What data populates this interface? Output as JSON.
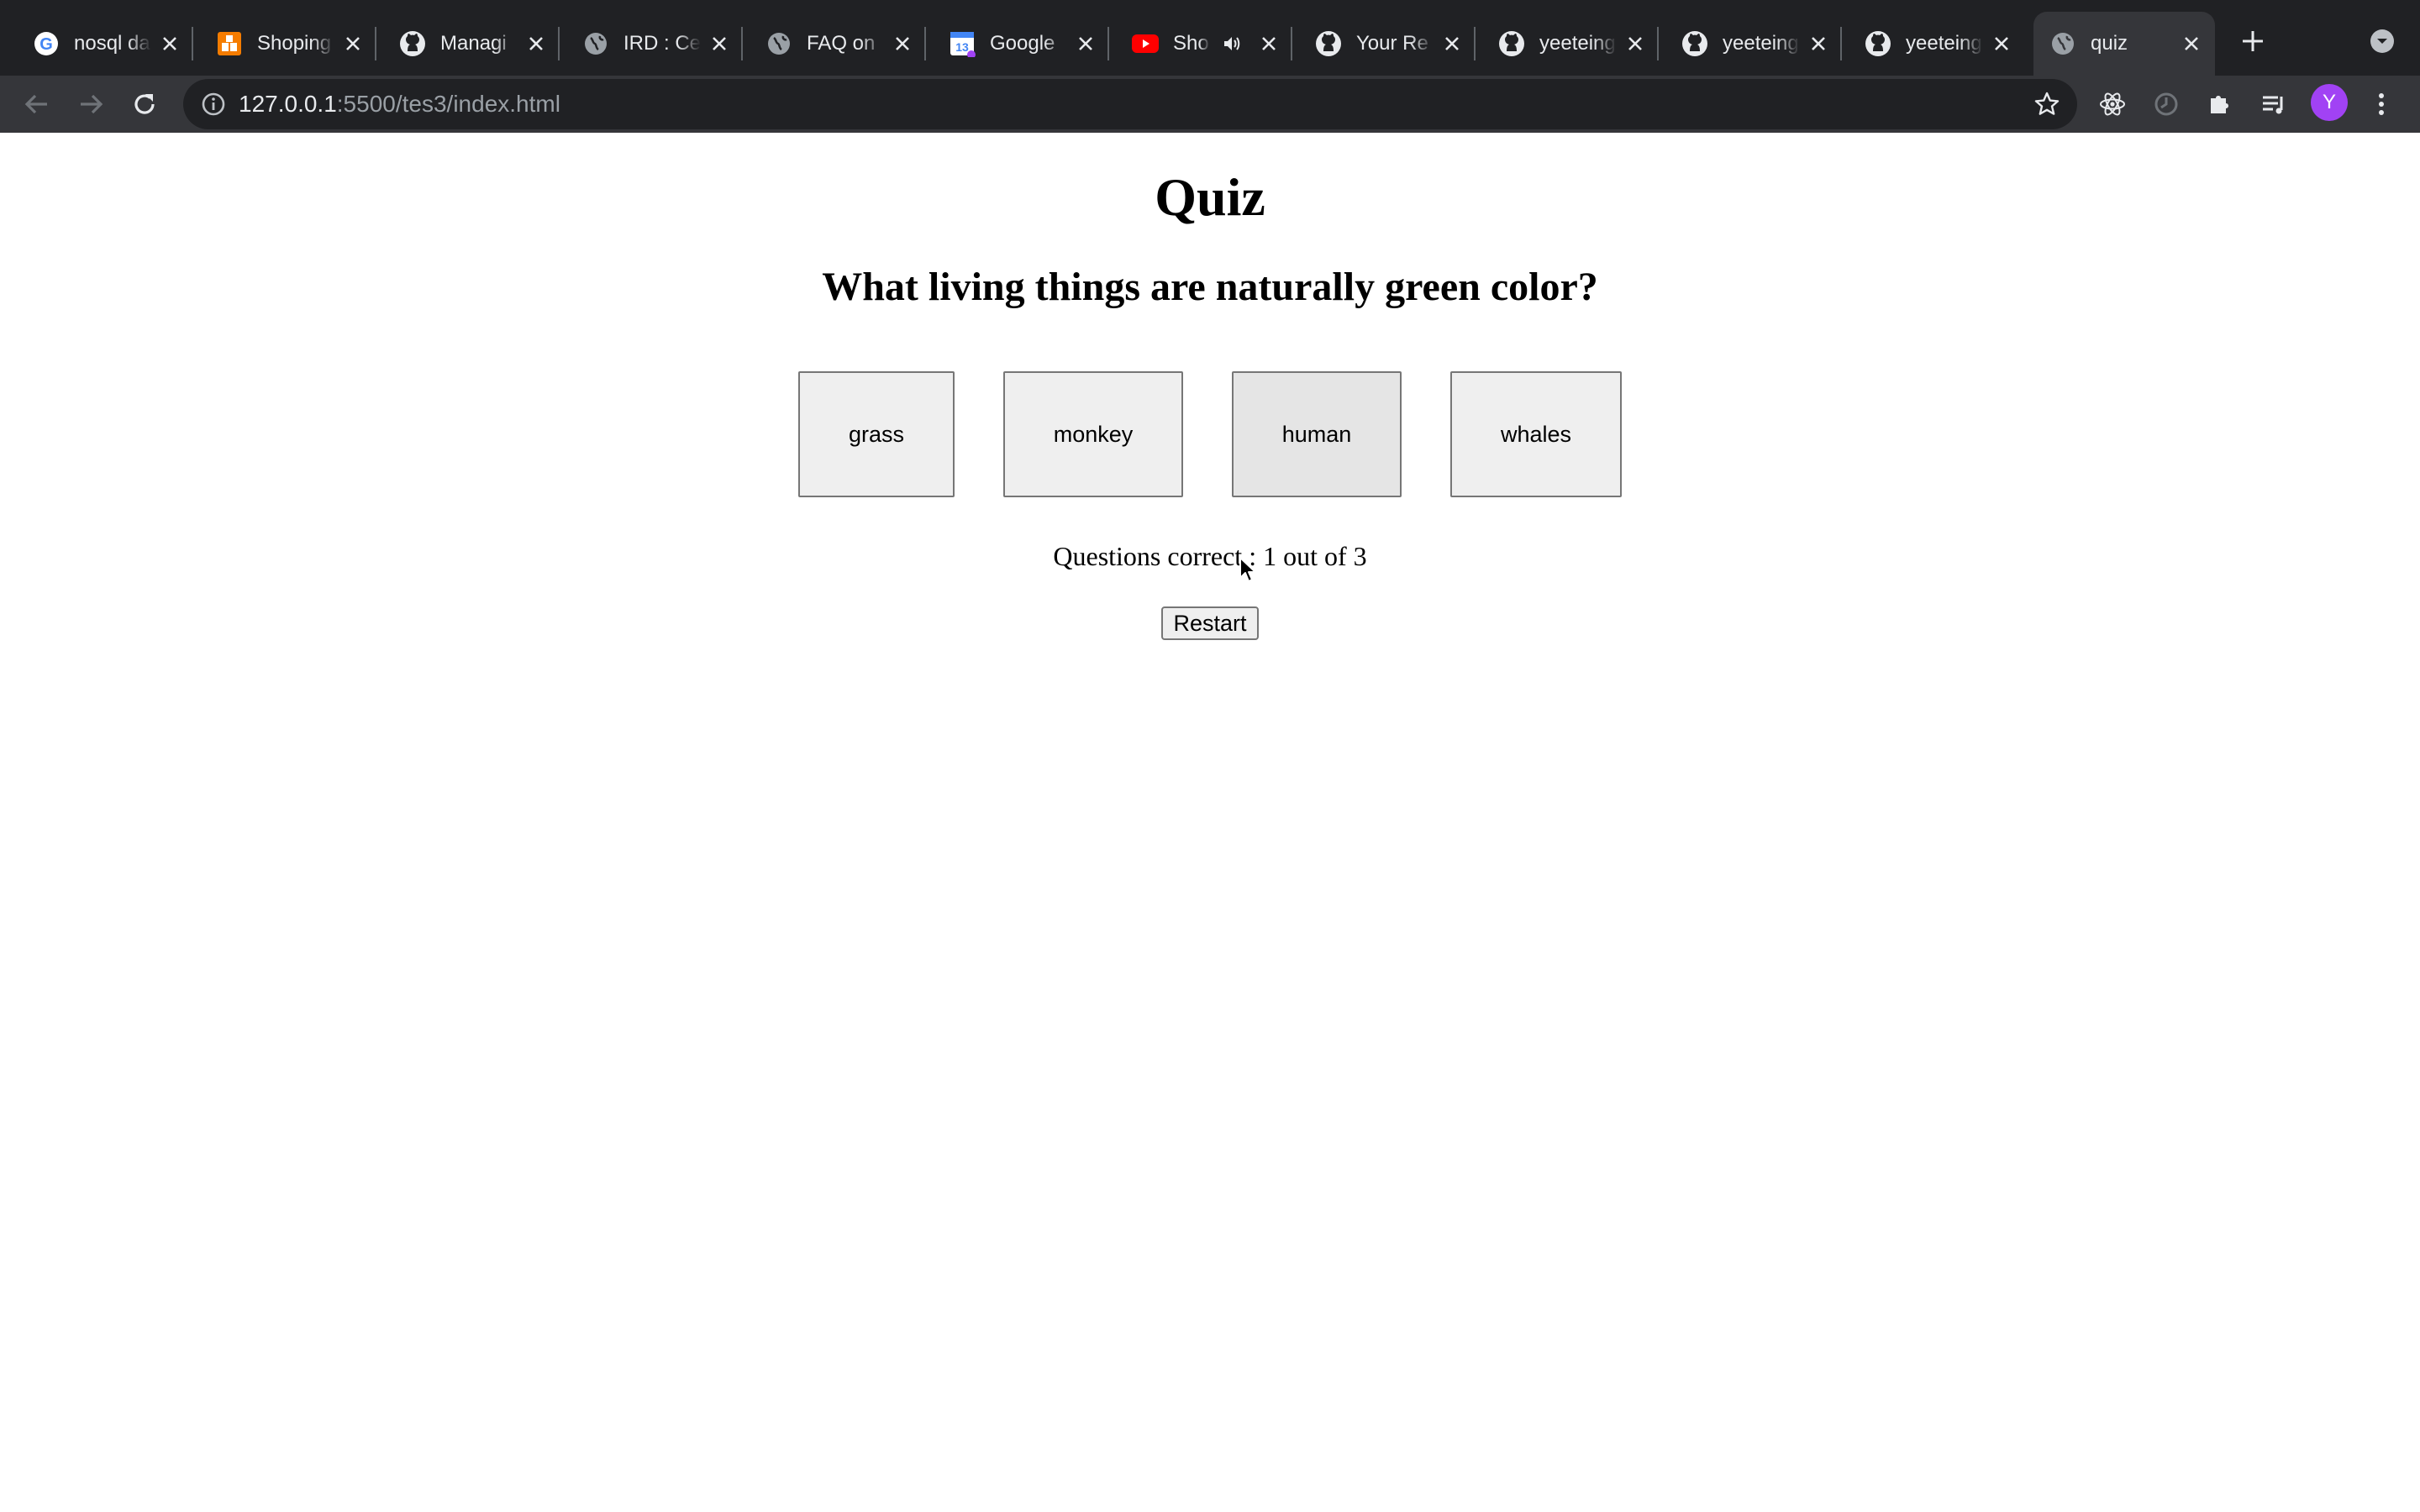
{
  "browser": {
    "tabs": [
      {
        "title": "nosql da",
        "icon": "google-icon"
      },
      {
        "title": "Shoping",
        "icon": "shop-icon"
      },
      {
        "title": "Managi",
        "icon": "github-icon"
      },
      {
        "title": "IRD : Ce",
        "icon": "globe-icon"
      },
      {
        "title": "FAQ on",
        "icon": "globe-icon"
      },
      {
        "title": "Google",
        "icon": "calendar-icon"
      },
      {
        "title": "Sho",
        "icon": "youtube-icon"
      },
      {
        "title": "Your Re",
        "icon": "github-icon"
      },
      {
        "title": "yeeteing",
        "icon": "github-icon"
      },
      {
        "title": "yeeteing",
        "icon": "github-icon"
      },
      {
        "title": "yeeteing",
        "icon": "github-icon"
      },
      {
        "title": "quiz",
        "icon": "globe-icon",
        "active": true
      }
    ],
    "url_host": "127.0.0.1",
    "url_rest": ":5500/tes3/index.html",
    "profile_initial": "Y",
    "colors": {
      "tabstrip": "#202124",
      "toolbar": "#35363a",
      "avatar": "#a142f4"
    }
  },
  "quiz": {
    "title": "Quiz",
    "question": "What living things are naturally green color?",
    "answers": [
      "grass",
      "monkey",
      "human",
      "whales"
    ],
    "score_text": "Questions correct : 1 out of 3",
    "restart_label": "Restart"
  }
}
